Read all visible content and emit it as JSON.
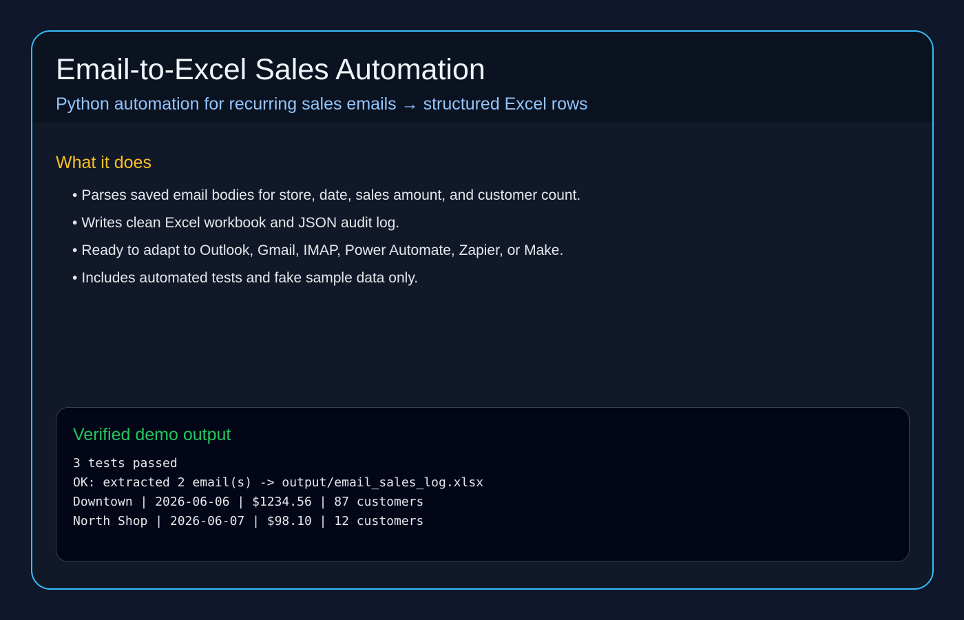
{
  "header": {
    "title": "Email-to-Excel Sales Automation",
    "subtitle": "Python automation for recurring sales emails → structured Excel rows"
  },
  "features": {
    "heading": "What it does",
    "items": [
      "Parses saved email bodies for store, date, sales amount, and customer count.",
      "Writes clean Excel workbook and JSON audit log.",
      "Ready to adapt to Outlook, Gmail, IMAP, Power Automate, Zapier, or Make.",
      "Includes automated tests and fake sample data only."
    ]
  },
  "output": {
    "heading": "Verified demo output",
    "lines": [
      "3 tests passed",
      "OK: extracted 2 email(s) -> output/email_sales_log.xlsx",
      "Downtown | 2026-06-06 | $1234.56 | 87 customers",
      "North Shop | 2026-06-07 | $98.10 | 12 customers"
    ]
  },
  "colors": {
    "background": "#0f172a",
    "card_border": "#38bdf8",
    "title": "#f1f5f9",
    "subtitle": "#93c5fd",
    "section_heading": "#fbbf24",
    "output_heading": "#22c55e"
  }
}
